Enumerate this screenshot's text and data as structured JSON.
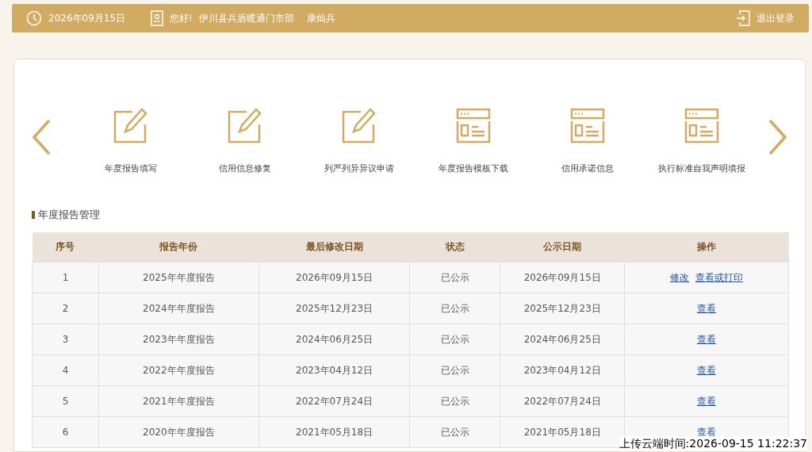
{
  "top_bar": {
    "date": "2026年09月15日",
    "greeting": "您好!",
    "organization": "伊川县兵盾暖通门市部",
    "user": "康灿兵",
    "logout": "退出登录"
  },
  "shortcuts": [
    {
      "label": "年度报告填写",
      "kind": "edit"
    },
    {
      "label": "信用信息修复",
      "kind": "edit"
    },
    {
      "label": "列严列异异议申请",
      "kind": "edit"
    },
    {
      "label": "年度报告模板下载",
      "kind": "form"
    },
    {
      "label": "信用承诺信息",
      "kind": "form"
    },
    {
      "label": "执行标准自我声明填报",
      "kind": "form"
    }
  ],
  "section_title": "年度报告管理",
  "table": {
    "columns": [
      "序号",
      "报告年份",
      "最后修改日期",
      "状态",
      "公示日期",
      "操作"
    ],
    "rows": [
      {
        "cells": [
          "1",
          "2025年年度报告",
          "2026年09月15日",
          "已公示",
          "2026年09月15日"
        ],
        "actions": [
          "修改",
          "查看或打印"
        ]
      },
      {
        "cells": [
          "2",
          "2024年年度报告",
          "2025年12月23日",
          "已公示",
          "2025年12月23日"
        ],
        "actions": [
          "查看"
        ]
      },
      {
        "cells": [
          "3",
          "2023年年度报告",
          "2024年06月25日",
          "已公示",
          "2024年06月25日"
        ],
        "actions": [
          "查看"
        ]
      },
      {
        "cells": [
          "4",
          "2022年年度报告",
          "2023年04月12日",
          "已公示",
          "2023年04月12日"
        ],
        "actions": [
          "查看"
        ]
      },
      {
        "cells": [
          "5",
          "2021年年度报告",
          "2022年07月24日",
          "已公示",
          "2022年07月24日"
        ],
        "actions": [
          "查看"
        ]
      },
      {
        "cells": [
          "6",
          "2020年年度报告",
          "2021年05月18日",
          "已公示",
          "2021年05月18日"
        ],
        "actions": [
          "查看"
        ]
      }
    ]
  },
  "upload_time": "上传云端时间:2026-09-15 11:22:37"
}
